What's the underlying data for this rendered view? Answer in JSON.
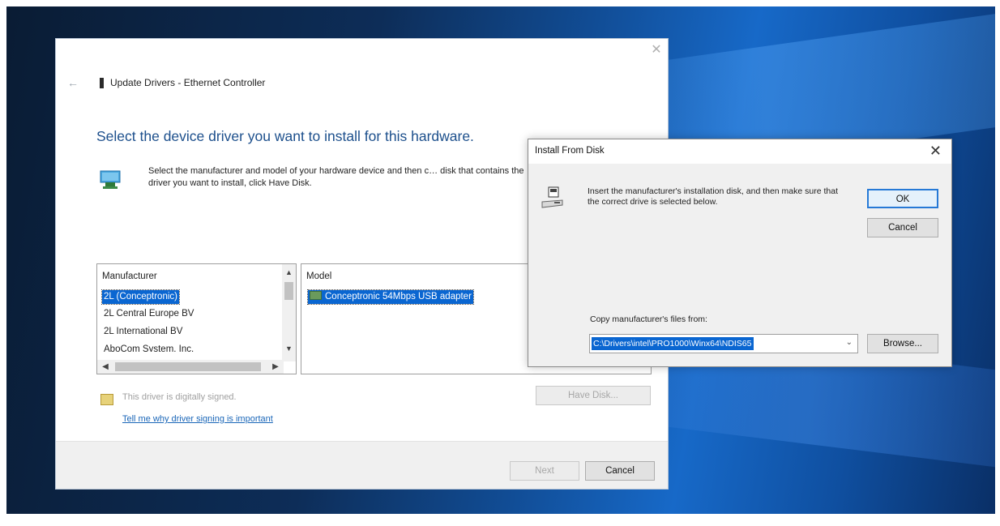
{
  "wizard": {
    "title": "Update Drivers - Ethernet Controller",
    "headline": "Select the device driver you want to install for this hardware.",
    "instructions": "Select the manufacturer and model of your hardware device and then c… disk that contains the driver you want to install, click Have Disk.",
    "manufacturer_list": {
      "header": "Manufacturer",
      "items": [
        "2L (Conceptronic)",
        "2L Central Europe BV",
        "2L International BV",
        "AboCom System, Inc."
      ],
      "selected_index": 0
    },
    "model_list": {
      "header": "Model",
      "items": [
        "Conceptronic 54Mbps USB adapter"
      ],
      "selected_index": 0
    },
    "signed_text": "This driver is digitally signed.",
    "signing_link": "Tell me why driver signing is important",
    "have_disk_label": "Have Disk...",
    "next_label": "Next",
    "cancel_label": "Cancel"
  },
  "disk_dialog": {
    "title": "Install From Disk",
    "message": "Insert the manufacturer's installation disk, and then make sure that the correct drive is selected below.",
    "ok_label": "OK",
    "cancel_label": "Cancel",
    "copy_label": "Copy manufacturer's files from:",
    "path_value": "C:\\Drivers\\intel\\PRO1000\\Winx64\\NDIS65",
    "browse_label": "Browse..."
  },
  "colors": {
    "headline": "#1c4f8c",
    "selection": "#0a66d1",
    "link": "#1a66b8",
    "desktop": "#114d96"
  },
  "icons": {
    "back": "back-arrow-icon",
    "close": "close-icon",
    "hardware": "network-hardware-icon",
    "disk": "disk-drive-icon",
    "signed": "certificate-icon"
  }
}
